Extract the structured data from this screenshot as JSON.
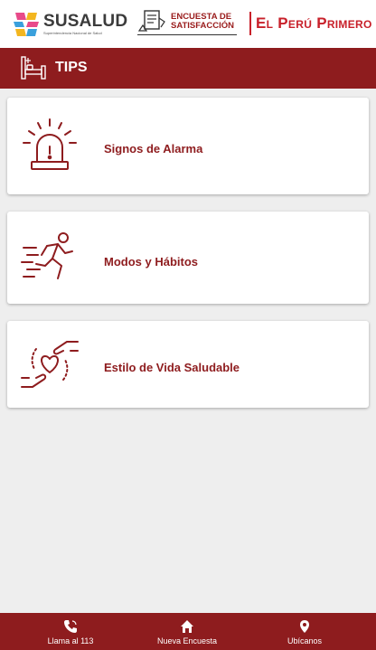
{
  "top_bar": {
    "susalud_logo": {
      "name": "SUSALUD",
      "subtitle": "Superintendencia Nacional de Salud"
    },
    "encuesta_logo": {
      "line1": "ENCUESTA DE",
      "line2": "SATISFACCIÓN"
    },
    "peru_logo": {
      "text": "El Perú Primero",
      "color": "#c8202a"
    }
  },
  "header": {
    "title": "TIPS",
    "icon": "hospital-bed-icon"
  },
  "cards": [
    {
      "label": "Signos de Alarma",
      "icon": "alarm-siren-icon"
    },
    {
      "label": "Modos y Hábitos",
      "icon": "running-person-icon"
    },
    {
      "label": "Estilo de Vida Saludable",
      "icon": "hands-heart-icon"
    }
  ],
  "bottom_nav": [
    {
      "label": "Llama al 113",
      "icon": "phone-icon"
    },
    {
      "label": "Nueva Encuesta",
      "icon": "home-icon"
    },
    {
      "label": "Ubícanos",
      "icon": "location-pin-icon"
    }
  ],
  "colors": {
    "primary": "#8e1c1e",
    "background": "#eeeeee",
    "card": "#ffffff"
  }
}
